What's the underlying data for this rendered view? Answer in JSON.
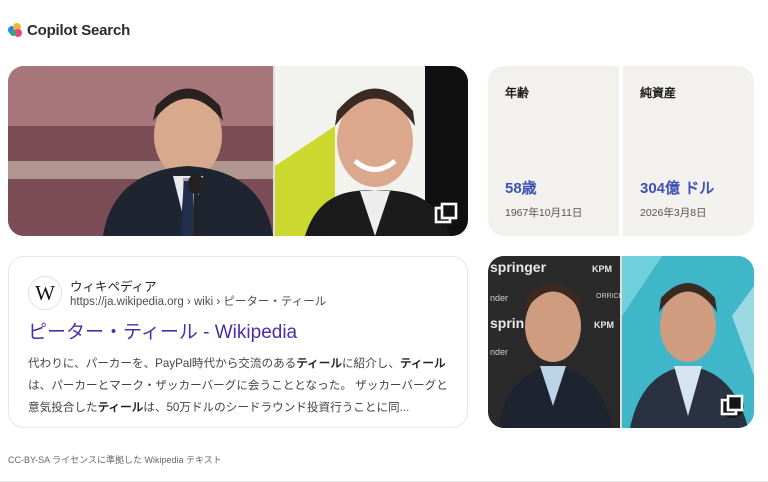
{
  "header": {
    "title": "Copilot Search",
    "logo_icon": "copilot-logo-icon"
  },
  "images_top": {
    "tiles": [
      {
        "alt": ""
      },
      {
        "alt": ""
      }
    ],
    "gallery_icon": "image-gallery-icon"
  },
  "stats": [
    {
      "label": "年齢",
      "value": "58歳",
      "sub": "1967年10月11日"
    },
    {
      "label": "純資産",
      "value": "304億 ドル",
      "sub": "2026年3月8日"
    }
  ],
  "result": {
    "site_name": "ウィキペディア",
    "url": "https://ja.wikipedia.org › wiki › ピーター・ティール",
    "title": "ピーター・ティール - Wikipedia",
    "snippet": [
      "代わりに、パーカーを、PayPal時代から交流のある",
      "ティール",
      "に紹介し、",
      "ティール",
      "は、パーカーとマーク・ザッカーバーグに会うこととなった。 ザッカーバーグと意気投合した",
      "ティール",
      "は、50万ドルのシードラウンド投資行うことに同..."
    ]
  },
  "images_bottom": {
    "gallery_icon": "image-gallery-icon"
  },
  "footer": {
    "note": "CC-BY-SA ライセンスに準拠した Wikipedia テキスト"
  },
  "colors": {
    "accent_value": "#3f51b5",
    "link_title": "#4a2ea8"
  }
}
